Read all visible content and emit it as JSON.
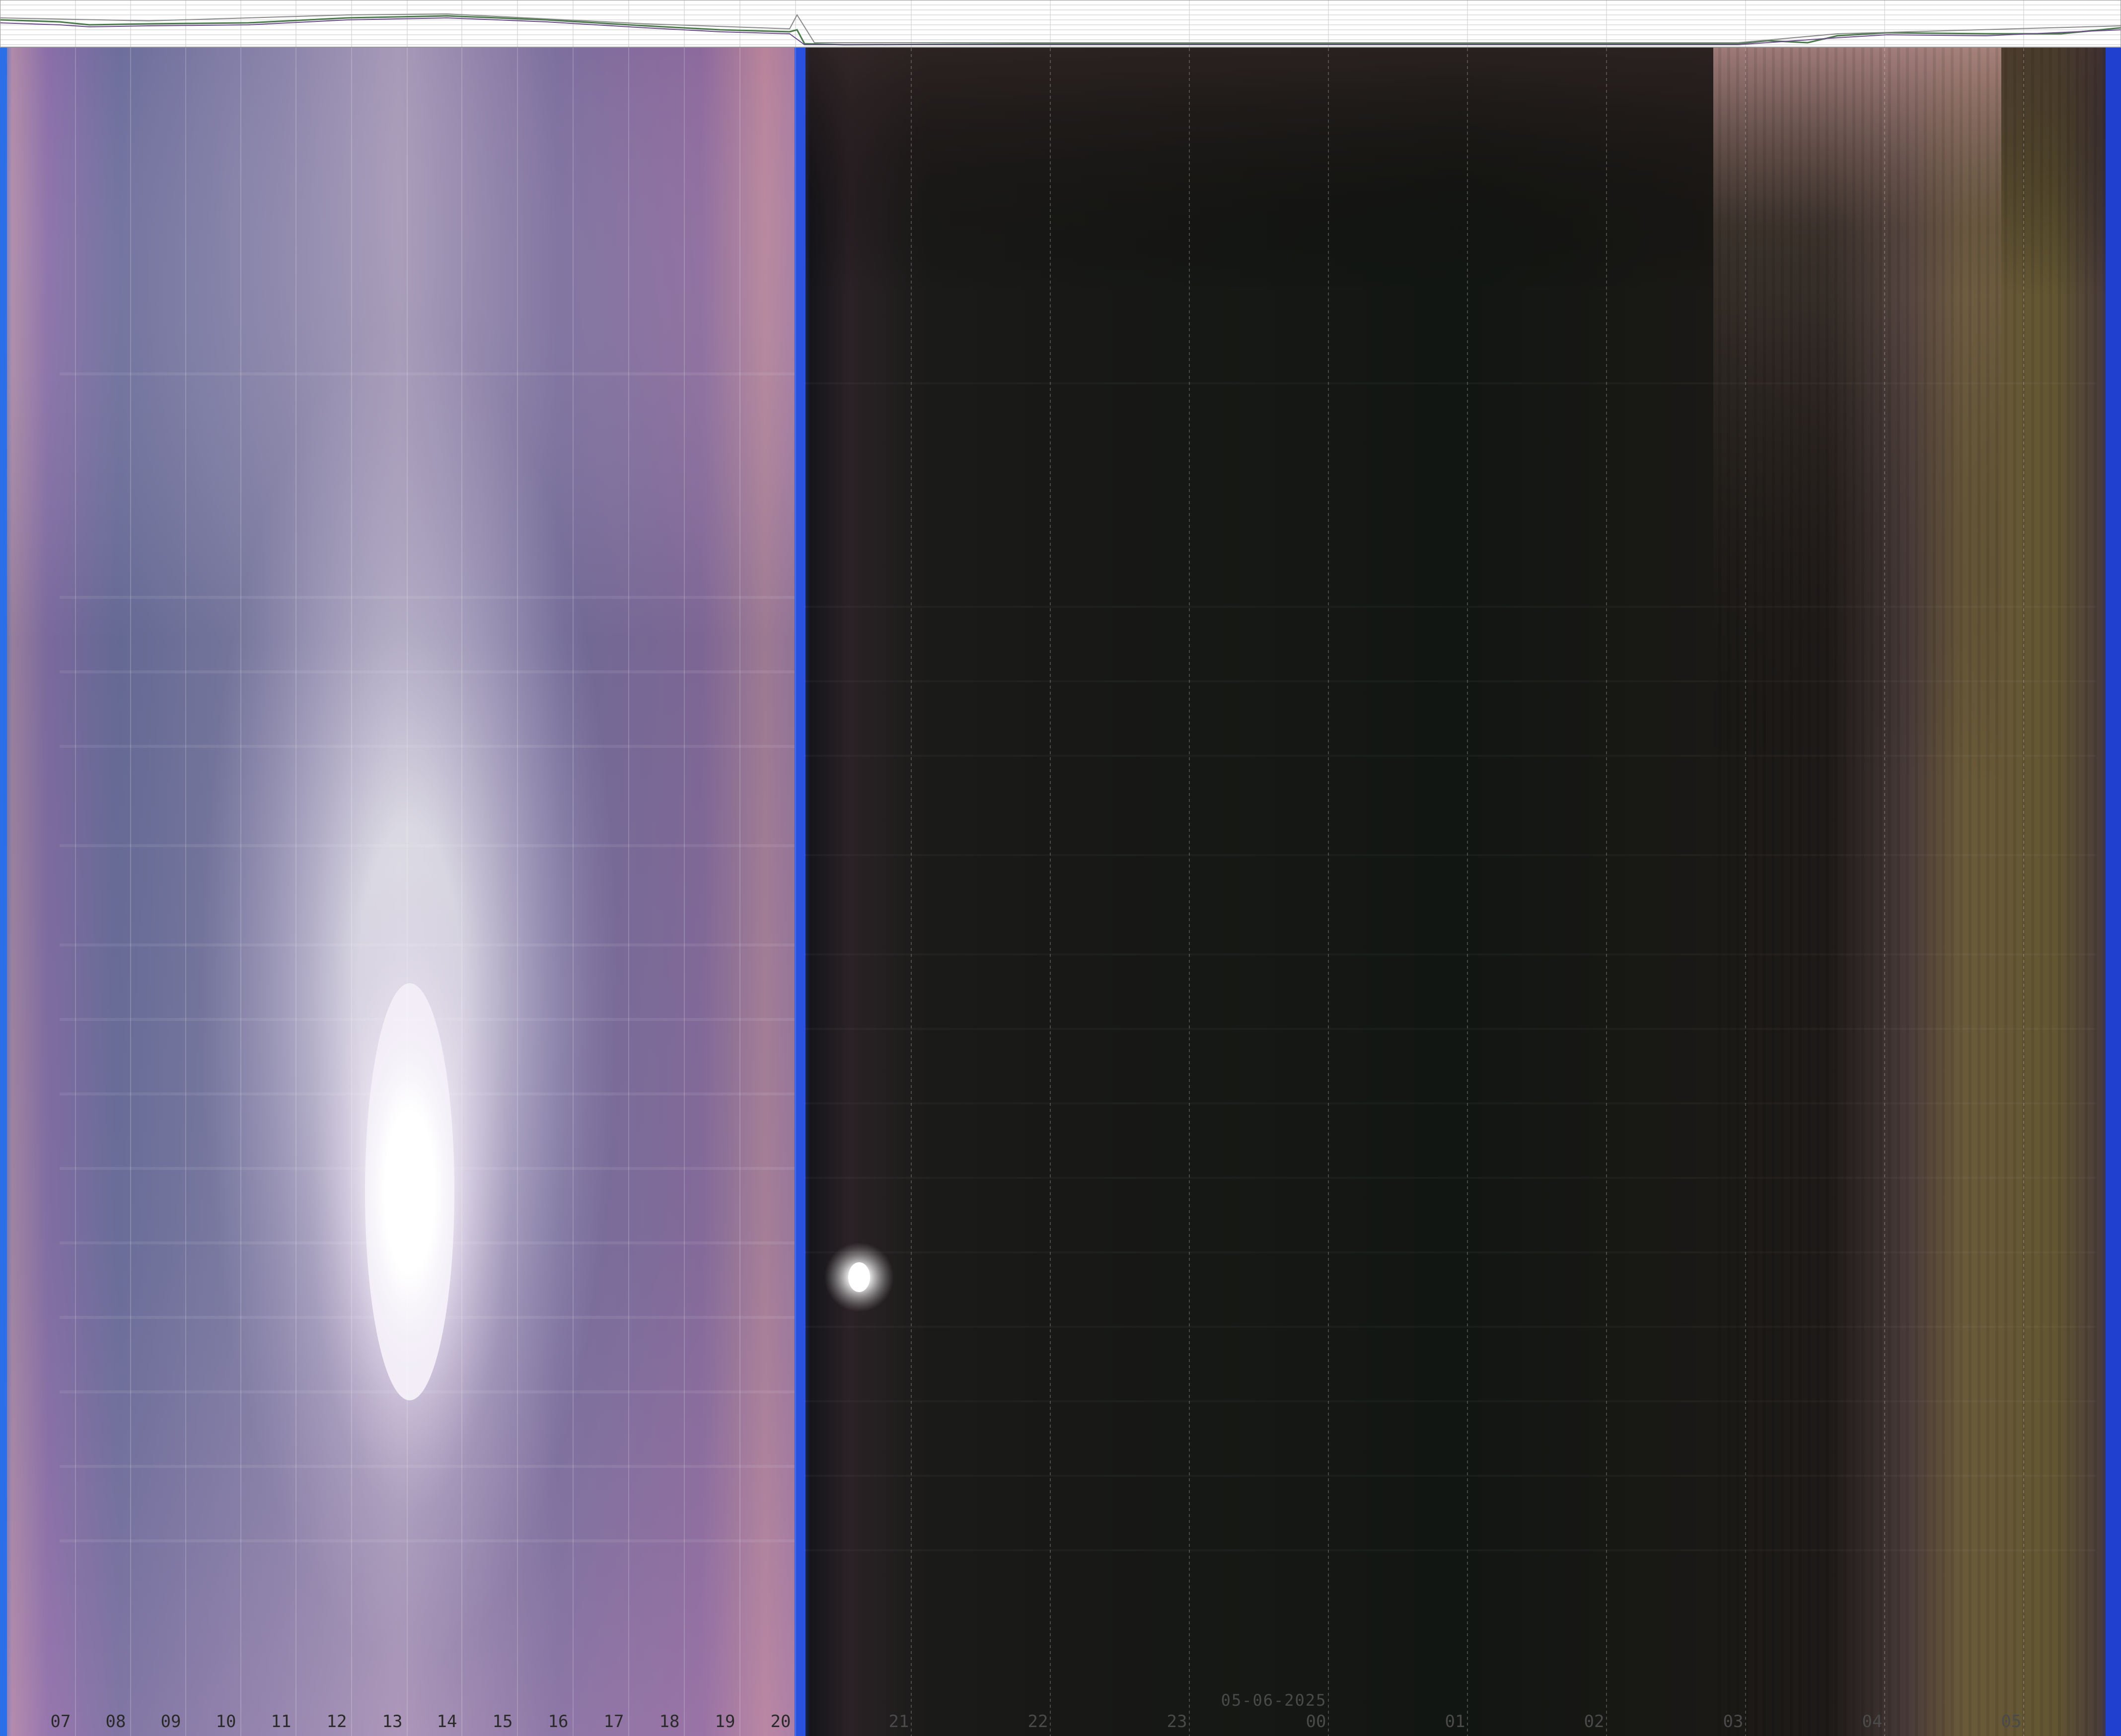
{
  "date_label": "05-06-2025",
  "day_hours": [
    "07",
    "08",
    "09",
    "10",
    "11",
    "12",
    "13",
    "14",
    "15",
    "16",
    "17",
    "18",
    "19",
    "20"
  ],
  "night_hours": [
    "21",
    "22",
    "23",
    "00",
    "01",
    "02",
    "03",
    "04",
    "05"
  ],
  "colors": {
    "day_sky": "#8e77a8",
    "day_edge": "#b889a2",
    "sun_glare": "#ffffff",
    "twilight_blue": "#2a5cff",
    "night_sky": "#141613",
    "dawn_olive": "#6e6438",
    "dawn_pink": "#a88a8c",
    "label_dark": "#2a2a2a",
    "label_light": "#4a4a4a",
    "graph_bg": "#ffffff",
    "graph_grid": "#c8c8c8"
  }
}
